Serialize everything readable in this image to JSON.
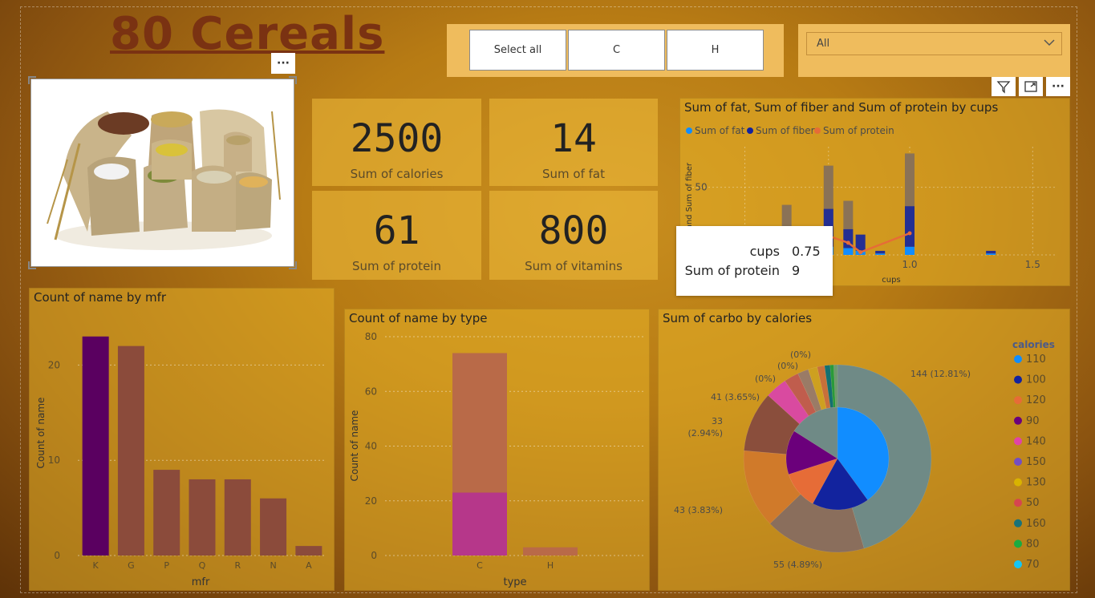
{
  "title": "80 Cereals",
  "slicer": {
    "buttons": [
      "Select all",
      "C",
      "H"
    ]
  },
  "dropdown": {
    "value": "All"
  },
  "visual_icons": [
    "filter-icon",
    "focus-mode-icon",
    "more-options-icon"
  ],
  "kpis": [
    {
      "value": "2500",
      "label": "Sum of calories"
    },
    {
      "value": "14",
      "label": "Sum of fat"
    },
    {
      "value": "61",
      "label": "Sum of protein"
    },
    {
      "value": "800",
      "label": "Sum of vitamins"
    }
  ],
  "tooltip": {
    "rows": [
      {
        "key": "cups",
        "value": "0.75"
      },
      {
        "key": "Sum of protein",
        "value": "9"
      }
    ]
  },
  "colors": {
    "fat": "#118dff",
    "fiber": "#12239e",
    "protein": "#e66c37",
    "title": "#7a3212"
  },
  "chart_data": [
    {
      "id": "combo",
      "type": "bar",
      "title": "Sum of fat, Sum of fiber and Sum of protein by cups",
      "legend": [
        "Sum of fat",
        "Sum of fiber",
        "Sum of protein"
      ],
      "xlabel": "cups",
      "ylabel": "fat and Sum of fiber",
      "x_ticks": [
        "1.0",
        "1.5"
      ],
      "y_ticks": [
        "50"
      ],
      "x": [
        0.33,
        0.5,
        0.67,
        0.75,
        0.8,
        0.88,
        1.0,
        1.33
      ],
      "series": [
        {
          "name": "Sum of fat",
          "values": [
            1,
            3,
            6,
            5,
            3,
            1,
            6,
            1
          ]
        },
        {
          "name": "Sum of fiber",
          "values": [
            2,
            8,
            28,
            14,
            12,
            2,
            30,
            2
          ]
        },
        {
          "name": "Sum of protein",
          "values": [
            null,
            null,
            14,
            9,
            2,
            null,
            16,
            null
          ]
        }
      ],
      "stack_totals": [
        14,
        37,
        66,
        40,
        15,
        3,
        75,
        3
      ],
      "ylim": [
        0,
        80
      ],
      "xlim": [
        0.1,
        1.6
      ]
    },
    {
      "id": "mfr",
      "type": "bar",
      "title": "Count of name by mfr",
      "categories": [
        "K",
        "G",
        "P",
        "Q",
        "R",
        "N",
        "A"
      ],
      "values": [
        23,
        22,
        9,
        8,
        8,
        6,
        1
      ],
      "colors": [
        "#5a0060",
        "#8b4b3b",
        "#8b4b3b",
        "#8b4b3b",
        "#8b4b3b",
        "#8b4b3b",
        "#8b4b3b"
      ],
      "xlabel": "mfr",
      "ylabel": "Count of name",
      "y_ticks": [
        0,
        10,
        20
      ],
      "ylim": [
        0,
        25
      ]
    },
    {
      "id": "type",
      "type": "bar",
      "title": "Count of name by type",
      "categories": [
        "C",
        "H"
      ],
      "series": [
        {
          "name": "highlight",
          "values": [
            23,
            0
          ],
          "color": "#b6378a"
        },
        {
          "name": "rest",
          "values": [
            51,
            3
          ],
          "color": "#b96a48"
        }
      ],
      "xlabel": "type",
      "ylabel": "Count of name",
      "y_ticks": [
        0,
        20,
        40,
        60,
        80
      ],
      "ylim": [
        0,
        80
      ]
    },
    {
      "id": "pie",
      "type": "pie",
      "title": "Sum of carbo by calories",
      "legend_title": "calories",
      "legend": [
        {
          "label": "110",
          "color": "#118dff"
        },
        {
          "label": "100",
          "color": "#12239e"
        },
        {
          "label": "120",
          "color": "#e66c37"
        },
        {
          "label": "90",
          "color": "#6b007b"
        },
        {
          "label": "140",
          "color": "#e044a7"
        },
        {
          "label": "150",
          "color": "#744ec2"
        },
        {
          "label": "130",
          "color": "#d9b300"
        },
        {
          "label": "50",
          "color": "#d64550"
        },
        {
          "label": "160",
          "color": "#197278"
        },
        {
          "label": "80",
          "color": "#1aab40"
        },
        {
          "label": "70",
          "color": "#15c6f4"
        }
      ],
      "outer_slices": [
        {
          "value": 144,
          "color": "#6f8a86"
        },
        {
          "value": 55,
          "color": "#8a6e5c"
        },
        {
          "value": 43,
          "color": "#d07a2a"
        },
        {
          "value": 33,
          "color": "#8a4e3c"
        },
        {
          "value": 12,
          "color": "#d94aa0"
        },
        {
          "value": 8,
          "color": "#c05d4d"
        },
        {
          "value": 6,
          "color": "#9a7b66"
        },
        {
          "value": 5,
          "color": "#cda020"
        },
        {
          "value": 4,
          "color": "#c8703a"
        },
        {
          "value": 3,
          "color": "#157070"
        },
        {
          "value": 2,
          "color": "#2a9a3a"
        },
        {
          "value": 2,
          "color": "#6e9a6e"
        }
      ],
      "inner_slices": [
        {
          "value": 40,
          "color": "#118dff"
        },
        {
          "value": 18,
          "color": "#12239e"
        },
        {
          "value": 12,
          "color": "#e66c37"
        },
        {
          "value": 14,
          "color": "#6b007b"
        },
        {
          "value": 16,
          "color": "#6f8a86"
        }
      ],
      "labels": [
        {
          "text": "144 (12.81%)"
        },
        {
          "text": "55 (4.89%)"
        },
        {
          "text": "43 (3.83%)"
        },
        {
          "text": "33"
        },
        {
          "text": "(2.94%)"
        },
        {
          "text": "41 (3.65%)"
        },
        {
          "text": "(0%)"
        },
        {
          "text": "(0%)"
        },
        {
          "text": "(0%)"
        }
      ]
    }
  ]
}
